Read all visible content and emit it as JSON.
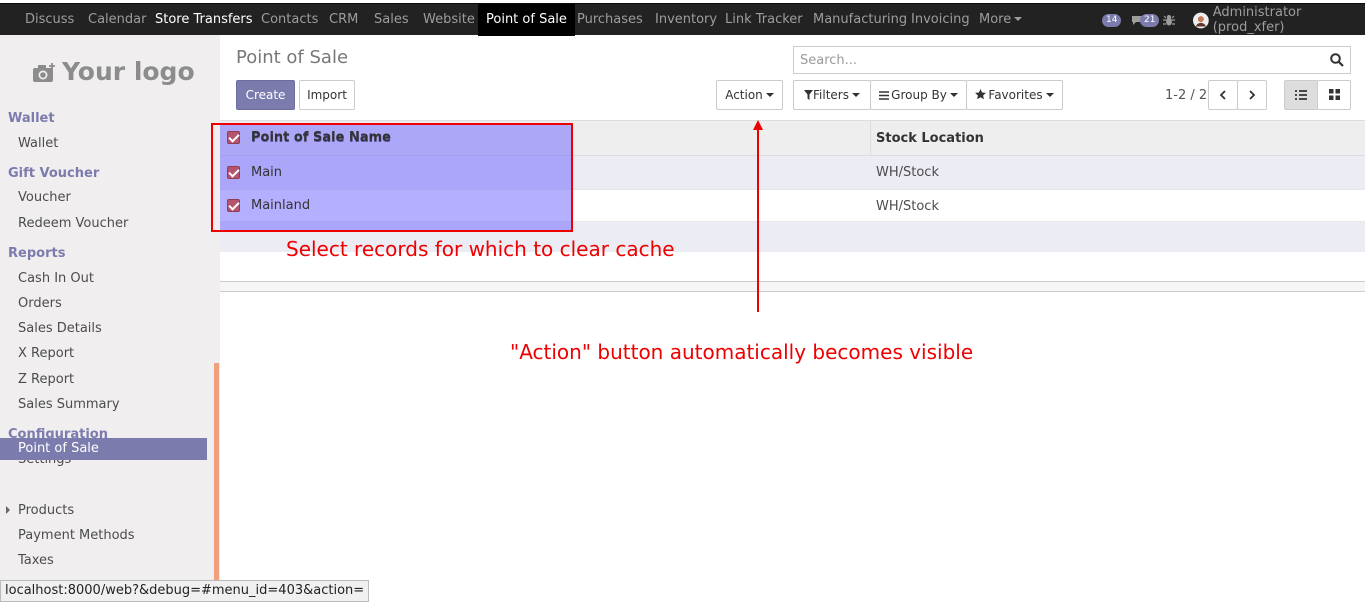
{
  "navbar": {
    "items": [
      "Discuss",
      "Calendar",
      "Store Transfers",
      "Contacts",
      "CRM",
      "Sales",
      "Website",
      "Point of Sale",
      "Purchases",
      "Inventory",
      "Link Tracker",
      "Manufacturing",
      "Invoicing",
      "More"
    ],
    "active": "Point of Sale",
    "activities_count": "14",
    "messages_count": "21",
    "user": "Administrator (prod_xfer)"
  },
  "sidebar": {
    "logo": "Your logo",
    "sections": [
      {
        "title": "Wallet",
        "items": [
          "Wallet"
        ]
      },
      {
        "title": "Gift Voucher",
        "items": [
          "Voucher",
          "Redeem Voucher"
        ]
      },
      {
        "title": "Reports",
        "items": [
          "Cash In Out",
          "Orders",
          "Sales Details",
          "X Report",
          "Z Report",
          "Sales Summary"
        ]
      },
      {
        "title": "Configuration",
        "items": [
          "Settings",
          "Point of Sale",
          "Products",
          "Payment Methods",
          "Taxes"
        ]
      }
    ],
    "active_item": "Point of Sale"
  },
  "control_panel": {
    "title": "Point of Sale",
    "create_label": "Create",
    "import_label": "Import",
    "action_label": "Action",
    "search_placeholder": "Search...",
    "filters_label": "Filters",
    "groupby_label": "Group By",
    "favorites_label": "Favorites",
    "pager": "1-2 / 2"
  },
  "list": {
    "columns": [
      "Point of Sale Name",
      "Stock Location"
    ],
    "rows": [
      {
        "name": "Main",
        "location": "WH/Stock",
        "selected": true
      },
      {
        "name": "Mainland",
        "location": "WH/Stock",
        "selected": true
      }
    ]
  },
  "annotations": {
    "select_note": "Select records for which to clear cache",
    "action_note": "\"Action\" button automatically becomes visible"
  },
  "statusbar": "localhost:8000/web?&debug=#menu_id=403&action=",
  "colors": {
    "brand": "#7c7bad",
    "annotation": "#e00000",
    "checkbox": "#b5546f"
  }
}
